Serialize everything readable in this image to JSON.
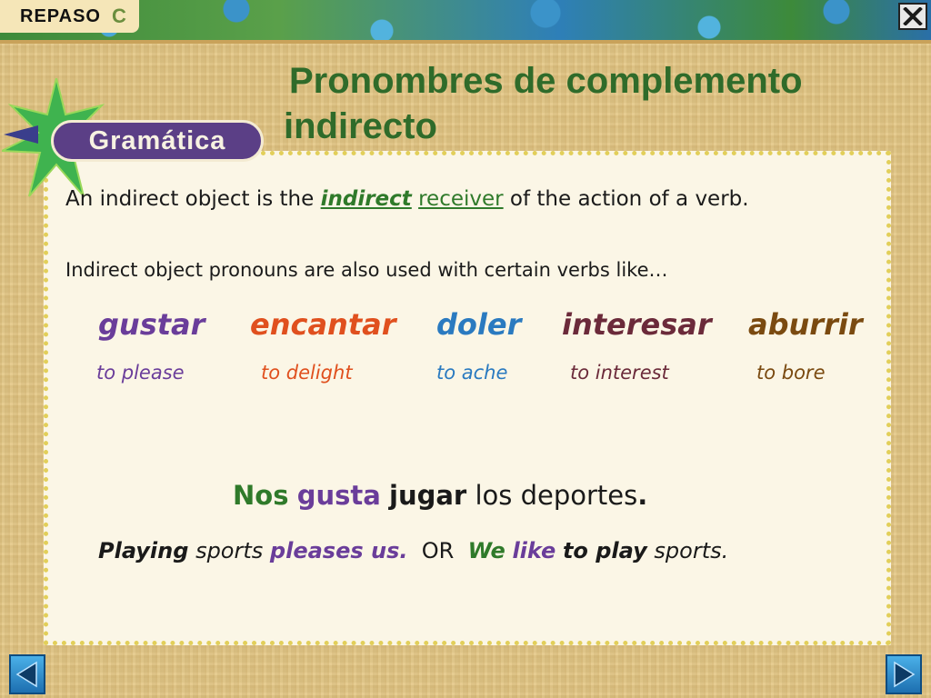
{
  "header": {
    "section_label": "REPASO",
    "section_letter": "C",
    "close_icon": "close-x-icon"
  },
  "title": {
    "line1": "Pronombres de complemento",
    "line2": "indirecto"
  },
  "badge": {
    "label": "Gramática",
    "colors": {
      "badge": "#5b3f86",
      "starburst": "#3fb34f",
      "arrow": "#3a3e8c"
    }
  },
  "definition": {
    "before": "An indirect object is the ",
    "highlight1": "indirect",
    "space": " ",
    "highlight2": "receiver",
    "after": " of the action of a verb."
  },
  "usage_line": "Indirect object pronouns are also used with certain verbs like…",
  "verbs": [
    {
      "spanish": "gustar",
      "english": "to please",
      "color": "#6a3d9a"
    },
    {
      "spanish": "encantar",
      "english": "to delight",
      "color": "#e0501e"
    },
    {
      "spanish": "doler",
      "english": "to ache",
      "color": "#2a7ac0"
    },
    {
      "spanish": "interesar",
      "english": "to interest",
      "color": "#6b2a3a"
    },
    {
      "spanish": "aburrir",
      "english": "to bore",
      "color": "#7a4a10"
    }
  ],
  "example": {
    "nos": "Nos",
    "gusta": "gusta",
    "jugar": "jugar",
    "rest": "los deportes",
    "period": "."
  },
  "translation": {
    "playing": "Playing",
    "sports1": "sports",
    "pleases_us": "pleases us.",
    "or": "OR",
    "we": "We",
    "like": "like",
    "to_play": "to play",
    "sports2": "sports."
  },
  "nav": {
    "prev_icon": "arrow-left-icon",
    "next_icon": "arrow-right-icon"
  }
}
